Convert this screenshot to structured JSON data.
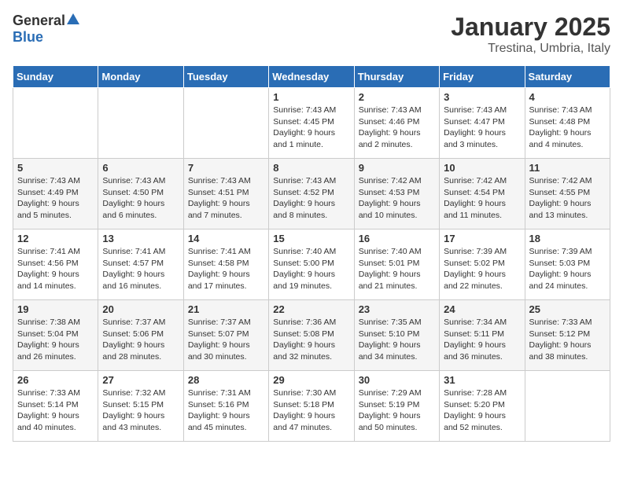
{
  "logo": {
    "general": "General",
    "blue": "Blue"
  },
  "header": {
    "month": "January 2025",
    "location": "Trestina, Umbria, Italy"
  },
  "weekdays": [
    "Sunday",
    "Monday",
    "Tuesday",
    "Wednesday",
    "Thursday",
    "Friday",
    "Saturday"
  ],
  "weeks": [
    [
      {
        "day": "",
        "info": ""
      },
      {
        "day": "",
        "info": ""
      },
      {
        "day": "",
        "info": ""
      },
      {
        "day": "1",
        "info": "Sunrise: 7:43 AM\nSunset: 4:45 PM\nDaylight: 9 hours and 1 minute."
      },
      {
        "day": "2",
        "info": "Sunrise: 7:43 AM\nSunset: 4:46 PM\nDaylight: 9 hours and 2 minutes."
      },
      {
        "day": "3",
        "info": "Sunrise: 7:43 AM\nSunset: 4:47 PM\nDaylight: 9 hours and 3 minutes."
      },
      {
        "day": "4",
        "info": "Sunrise: 7:43 AM\nSunset: 4:48 PM\nDaylight: 9 hours and 4 minutes."
      }
    ],
    [
      {
        "day": "5",
        "info": "Sunrise: 7:43 AM\nSunset: 4:49 PM\nDaylight: 9 hours and 5 minutes."
      },
      {
        "day": "6",
        "info": "Sunrise: 7:43 AM\nSunset: 4:50 PM\nDaylight: 9 hours and 6 minutes."
      },
      {
        "day": "7",
        "info": "Sunrise: 7:43 AM\nSunset: 4:51 PM\nDaylight: 9 hours and 7 minutes."
      },
      {
        "day": "8",
        "info": "Sunrise: 7:43 AM\nSunset: 4:52 PM\nDaylight: 9 hours and 8 minutes."
      },
      {
        "day": "9",
        "info": "Sunrise: 7:42 AM\nSunset: 4:53 PM\nDaylight: 9 hours and 10 minutes."
      },
      {
        "day": "10",
        "info": "Sunrise: 7:42 AM\nSunset: 4:54 PM\nDaylight: 9 hours and 11 minutes."
      },
      {
        "day": "11",
        "info": "Sunrise: 7:42 AM\nSunset: 4:55 PM\nDaylight: 9 hours and 13 minutes."
      }
    ],
    [
      {
        "day": "12",
        "info": "Sunrise: 7:41 AM\nSunset: 4:56 PM\nDaylight: 9 hours and 14 minutes."
      },
      {
        "day": "13",
        "info": "Sunrise: 7:41 AM\nSunset: 4:57 PM\nDaylight: 9 hours and 16 minutes."
      },
      {
        "day": "14",
        "info": "Sunrise: 7:41 AM\nSunset: 4:58 PM\nDaylight: 9 hours and 17 minutes."
      },
      {
        "day": "15",
        "info": "Sunrise: 7:40 AM\nSunset: 5:00 PM\nDaylight: 9 hours and 19 minutes."
      },
      {
        "day": "16",
        "info": "Sunrise: 7:40 AM\nSunset: 5:01 PM\nDaylight: 9 hours and 21 minutes."
      },
      {
        "day": "17",
        "info": "Sunrise: 7:39 AM\nSunset: 5:02 PM\nDaylight: 9 hours and 22 minutes."
      },
      {
        "day": "18",
        "info": "Sunrise: 7:39 AM\nSunset: 5:03 PM\nDaylight: 9 hours and 24 minutes."
      }
    ],
    [
      {
        "day": "19",
        "info": "Sunrise: 7:38 AM\nSunset: 5:04 PM\nDaylight: 9 hours and 26 minutes."
      },
      {
        "day": "20",
        "info": "Sunrise: 7:37 AM\nSunset: 5:06 PM\nDaylight: 9 hours and 28 minutes."
      },
      {
        "day": "21",
        "info": "Sunrise: 7:37 AM\nSunset: 5:07 PM\nDaylight: 9 hours and 30 minutes."
      },
      {
        "day": "22",
        "info": "Sunrise: 7:36 AM\nSunset: 5:08 PM\nDaylight: 9 hours and 32 minutes."
      },
      {
        "day": "23",
        "info": "Sunrise: 7:35 AM\nSunset: 5:10 PM\nDaylight: 9 hours and 34 minutes."
      },
      {
        "day": "24",
        "info": "Sunrise: 7:34 AM\nSunset: 5:11 PM\nDaylight: 9 hours and 36 minutes."
      },
      {
        "day": "25",
        "info": "Sunrise: 7:33 AM\nSunset: 5:12 PM\nDaylight: 9 hours and 38 minutes."
      }
    ],
    [
      {
        "day": "26",
        "info": "Sunrise: 7:33 AM\nSunset: 5:14 PM\nDaylight: 9 hours and 40 minutes."
      },
      {
        "day": "27",
        "info": "Sunrise: 7:32 AM\nSunset: 5:15 PM\nDaylight: 9 hours and 43 minutes."
      },
      {
        "day": "28",
        "info": "Sunrise: 7:31 AM\nSunset: 5:16 PM\nDaylight: 9 hours and 45 minutes."
      },
      {
        "day": "29",
        "info": "Sunrise: 7:30 AM\nSunset: 5:18 PM\nDaylight: 9 hours and 47 minutes."
      },
      {
        "day": "30",
        "info": "Sunrise: 7:29 AM\nSunset: 5:19 PM\nDaylight: 9 hours and 50 minutes."
      },
      {
        "day": "31",
        "info": "Sunrise: 7:28 AM\nSunset: 5:20 PM\nDaylight: 9 hours and 52 minutes."
      },
      {
        "day": "",
        "info": ""
      }
    ]
  ]
}
